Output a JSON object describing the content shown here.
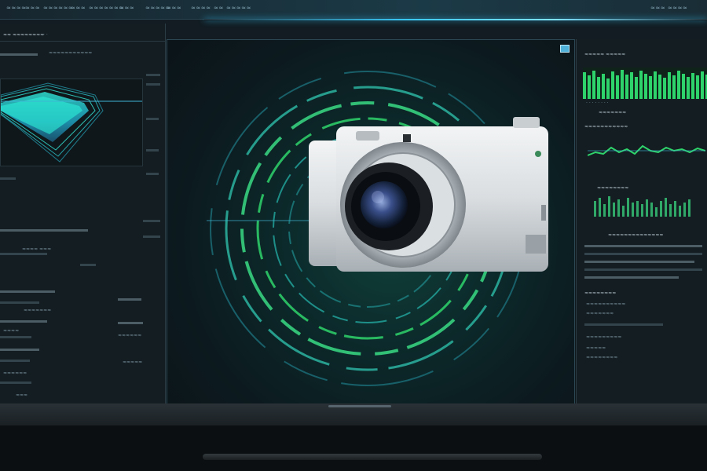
{
  "top_menu": {
    "items": [
      "≈≈≈≈",
      "≈≈≈",
      "≈≈≈≈≈≈",
      "≈≈≈",
      "≈≈≈≈≈≈≈",
      "≈≈≈",
      "≈≈≈≈≈",
      "≈≈≈",
      "≈≈≈≈",
      "≈≈",
      "≈≈≈≈≈"
    ],
    "right_text": "≈≈≈ ≈≈≈≈"
  },
  "left_panel": {
    "header": "≈≈ ≈≈≈≈≈≈≈≈",
    "subheader": "≈≈≈≈≈≈≈≈≈≈≈",
    "label_middle": "≈≈≈≈ ≈≈≈",
    "rows": [
      "≈≈≈≈≈≈≈",
      "≈≈≈≈",
      "≈≈≈≈≈≈",
      "≈≈≈≈≈",
      "≈≈≈≈≈≈",
      "≈≈≈"
    ]
  },
  "right_panel": {
    "title": "≈≈≈≈≈ ≈≈≈≈≈",
    "section1": "≈≈≈≈≈≈≈",
    "section2": "≈≈≈≈≈≈≈≈≈≈≈",
    "section3": "≈≈≈≈≈≈≈≈",
    "section4": "≈≈≈≈≈≈≈≈≈≈≈≈≈≈",
    "rows": [
      "≈≈≈≈≈≈≈≈",
      "≈≈≈≈≈≈≈≈≈≈",
      "≈≈≈≈≈≈≈",
      "≈≈≈≈≈≈≈≈≈",
      "≈≈≈≈≈",
      "≈≈≈≈≈≈≈≈"
    ]
  },
  "colors": {
    "accent_cyan": "#39c7f5",
    "accent_green": "#2fd36b",
    "panel_bg": "#141d22"
  },
  "icons": {
    "corner": "image-icon",
    "camera": "camera-icon"
  }
}
